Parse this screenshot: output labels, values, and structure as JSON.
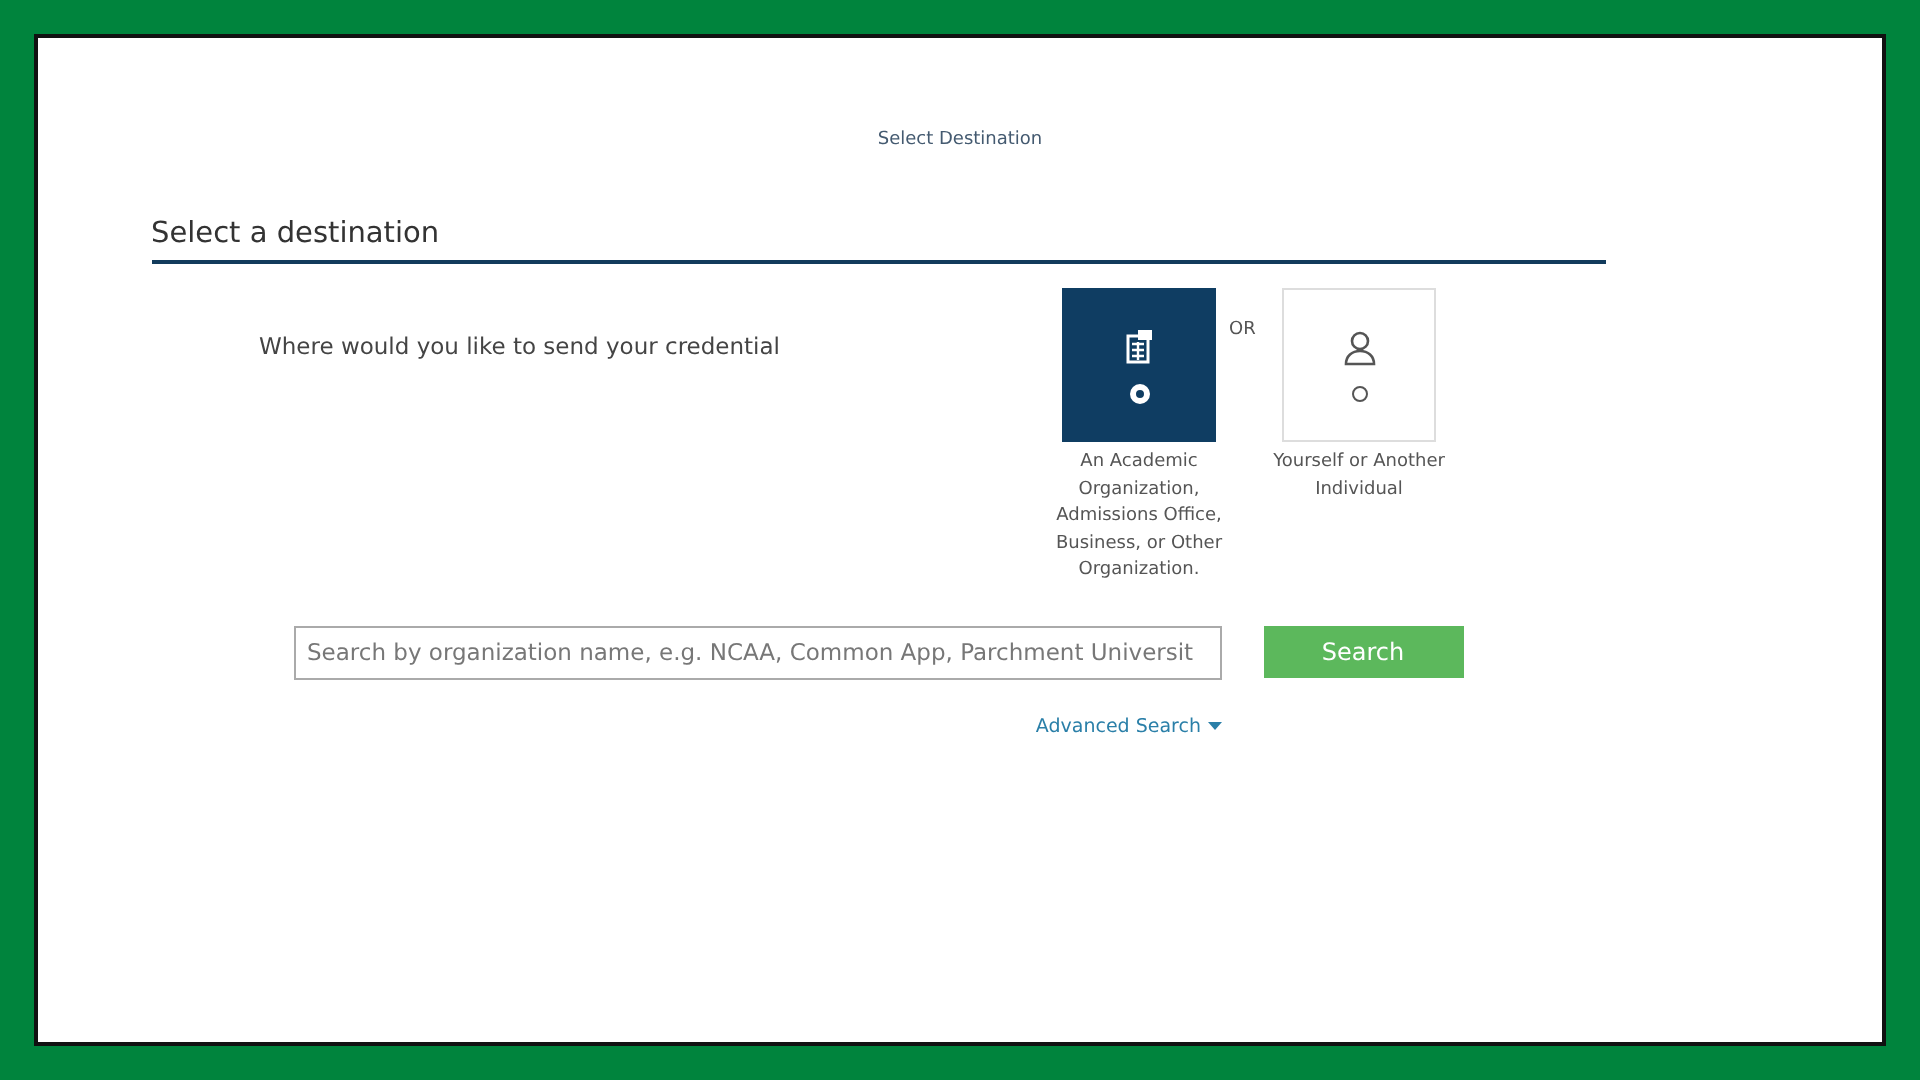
{
  "breadcrumb": "Select Destination",
  "heading": "Select a destination",
  "question": "Where would you like to send your credential",
  "options": [
    {
      "kind": "organization",
      "label": "An Academic Organization, Admissions Office, Business, or Other Organization.",
      "selected": true
    },
    {
      "kind": "individual",
      "label": "Yourself or Another Individual",
      "selected": false
    }
  ],
  "separator": "OR",
  "search": {
    "placeholder": "Search by organization name, e.g. NCAA, Common App, Parchment Universit",
    "button": "Search"
  },
  "advanced_search": "Advanced Search"
}
